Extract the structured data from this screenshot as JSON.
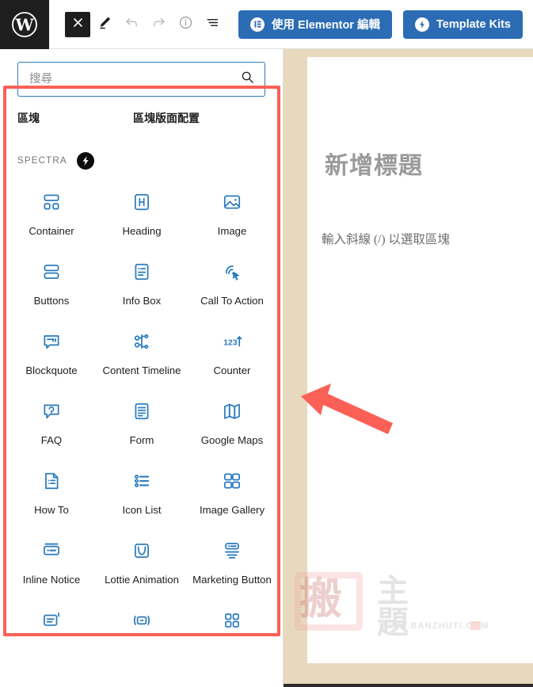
{
  "toolbar": {
    "logo_icon": "wordpress-logo",
    "buttons": [
      {
        "name": "close-editor-button",
        "icon": "close-x-icon",
        "state": "active"
      },
      {
        "name": "edit-tool-button",
        "icon": "pencil-icon",
        "state": "default"
      },
      {
        "name": "undo-button",
        "icon": "undo-arrow-icon",
        "state": "disabled"
      },
      {
        "name": "redo-button",
        "icon": "redo-arrow-icon",
        "state": "disabled"
      },
      {
        "name": "details-button",
        "icon": "info-circle-icon",
        "state": "default"
      },
      {
        "name": "list-view-button",
        "icon": "list-view-icon",
        "state": "default"
      }
    ],
    "elementor_button": {
      "label": "使用 Elementor 編輯",
      "icon": "elementor-icon"
    },
    "template_kits_button": {
      "label": "Template Kits",
      "icon": "lightning-bolt-icon"
    },
    "accent_color": "#2b6cb4"
  },
  "inserter": {
    "search": {
      "placeholder": "搜尋",
      "value": "",
      "icon": "search-icon"
    },
    "tabs": [
      {
        "label": "區塊",
        "selected": true
      },
      {
        "label": "區塊版面配置",
        "selected": false
      }
    ],
    "category": {
      "title": "SPECTRA",
      "icon": "spectra-bolt-icon"
    },
    "highlight_color": "#fb6056",
    "icon_color": "#2b7bbd",
    "blocks": [
      {
        "label": "Container",
        "icon": "container-icon"
      },
      {
        "label": "Heading",
        "icon": "heading-h-icon"
      },
      {
        "label": "Image",
        "icon": "image-icon"
      },
      {
        "label": "Buttons",
        "icon": "buttons-icon"
      },
      {
        "label": "Info Box",
        "icon": "info-box-icon"
      },
      {
        "label": "Call To Action",
        "icon": "call-to-action-cursor-icon"
      },
      {
        "label": "Blockquote",
        "icon": "blockquote-icon"
      },
      {
        "label": "Content Timeline",
        "icon": "content-timeline-icon"
      },
      {
        "label": "Counter",
        "icon": "counter-123-icon"
      },
      {
        "label": "FAQ",
        "icon": "faq-question-icon"
      },
      {
        "label": "Form",
        "icon": "form-icon"
      },
      {
        "label": "Google Maps",
        "icon": "google-maps-icon"
      },
      {
        "label": "How To",
        "icon": "how-to-document-icon"
      },
      {
        "label": "Icon List",
        "icon": "icon-list-icon"
      },
      {
        "label": "Image Gallery",
        "icon": "image-gallery-icon"
      },
      {
        "label": "Inline Notice",
        "icon": "inline-notice-icon"
      },
      {
        "label": "Lottie Animation",
        "icon": "lottie-curve-icon"
      },
      {
        "label": "Marketing Button",
        "icon": "marketing-button-icon"
      },
      {
        "label": "",
        "icon": "modal-popup-icon"
      },
      {
        "label": "",
        "icon": "marquee-icon"
      },
      {
        "label": "",
        "icon": "post-grid-icon"
      }
    ]
  },
  "canvas": {
    "title_placeholder": "新增標題",
    "body_placeholder": "輸入斜線 (/) 以選取區塊",
    "page_background": "#ffffff",
    "frame_background": "#e7d9bd"
  },
  "watermark": {
    "seal_char": "搬",
    "chars": "主 題",
    "url": "WWW.BANZHUTI.COM"
  },
  "annotation": {
    "arrow": {
      "color": "#fb6056",
      "points_to": "block-inserter-panel"
    }
  }
}
